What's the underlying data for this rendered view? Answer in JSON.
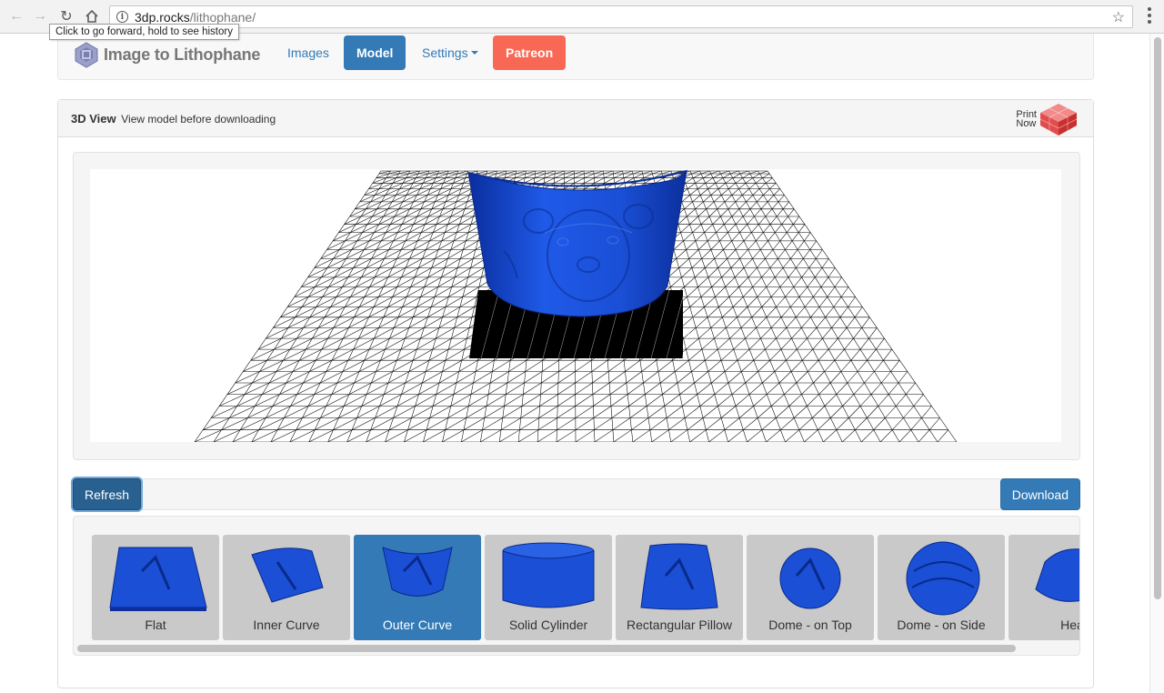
{
  "browser": {
    "url_host": "3dp.rocks",
    "url_path": "/lithophane/",
    "tooltip": "Click to go forward, hold to see history"
  },
  "navbar": {
    "brand": "Image to Lithophane",
    "links": [
      "Images",
      "Model",
      "Settings",
      "Patreon"
    ],
    "active": "Model"
  },
  "panel": {
    "title": "3D View",
    "subtitle": "View model before downloading",
    "print_now_line1": "Print",
    "print_now_line2": "Now"
  },
  "buttons": {
    "refresh": "Refresh",
    "download": "Download"
  },
  "shapes": [
    {
      "label": "Flat",
      "icon": "flat-shape-icon"
    },
    {
      "label": "Inner Curve",
      "icon": "inner-curve-shape-icon"
    },
    {
      "label": "Outer Curve",
      "icon": "outer-curve-shape-icon",
      "selected": true
    },
    {
      "label": "Solid Cylinder",
      "icon": "cylinder-shape-icon"
    },
    {
      "label": "Rectangular Pillow",
      "icon": "pillow-shape-icon"
    },
    {
      "label": "Dome - on Top",
      "icon": "dome-top-shape-icon"
    },
    {
      "label": "Dome - on Side",
      "icon": "dome-side-shape-icon"
    },
    {
      "label": "Hea",
      "icon": "heart-shape-icon"
    }
  ],
  "colors": {
    "primary": "#337ab7",
    "patreon": "#f96854",
    "model": "#1a4fd6"
  }
}
